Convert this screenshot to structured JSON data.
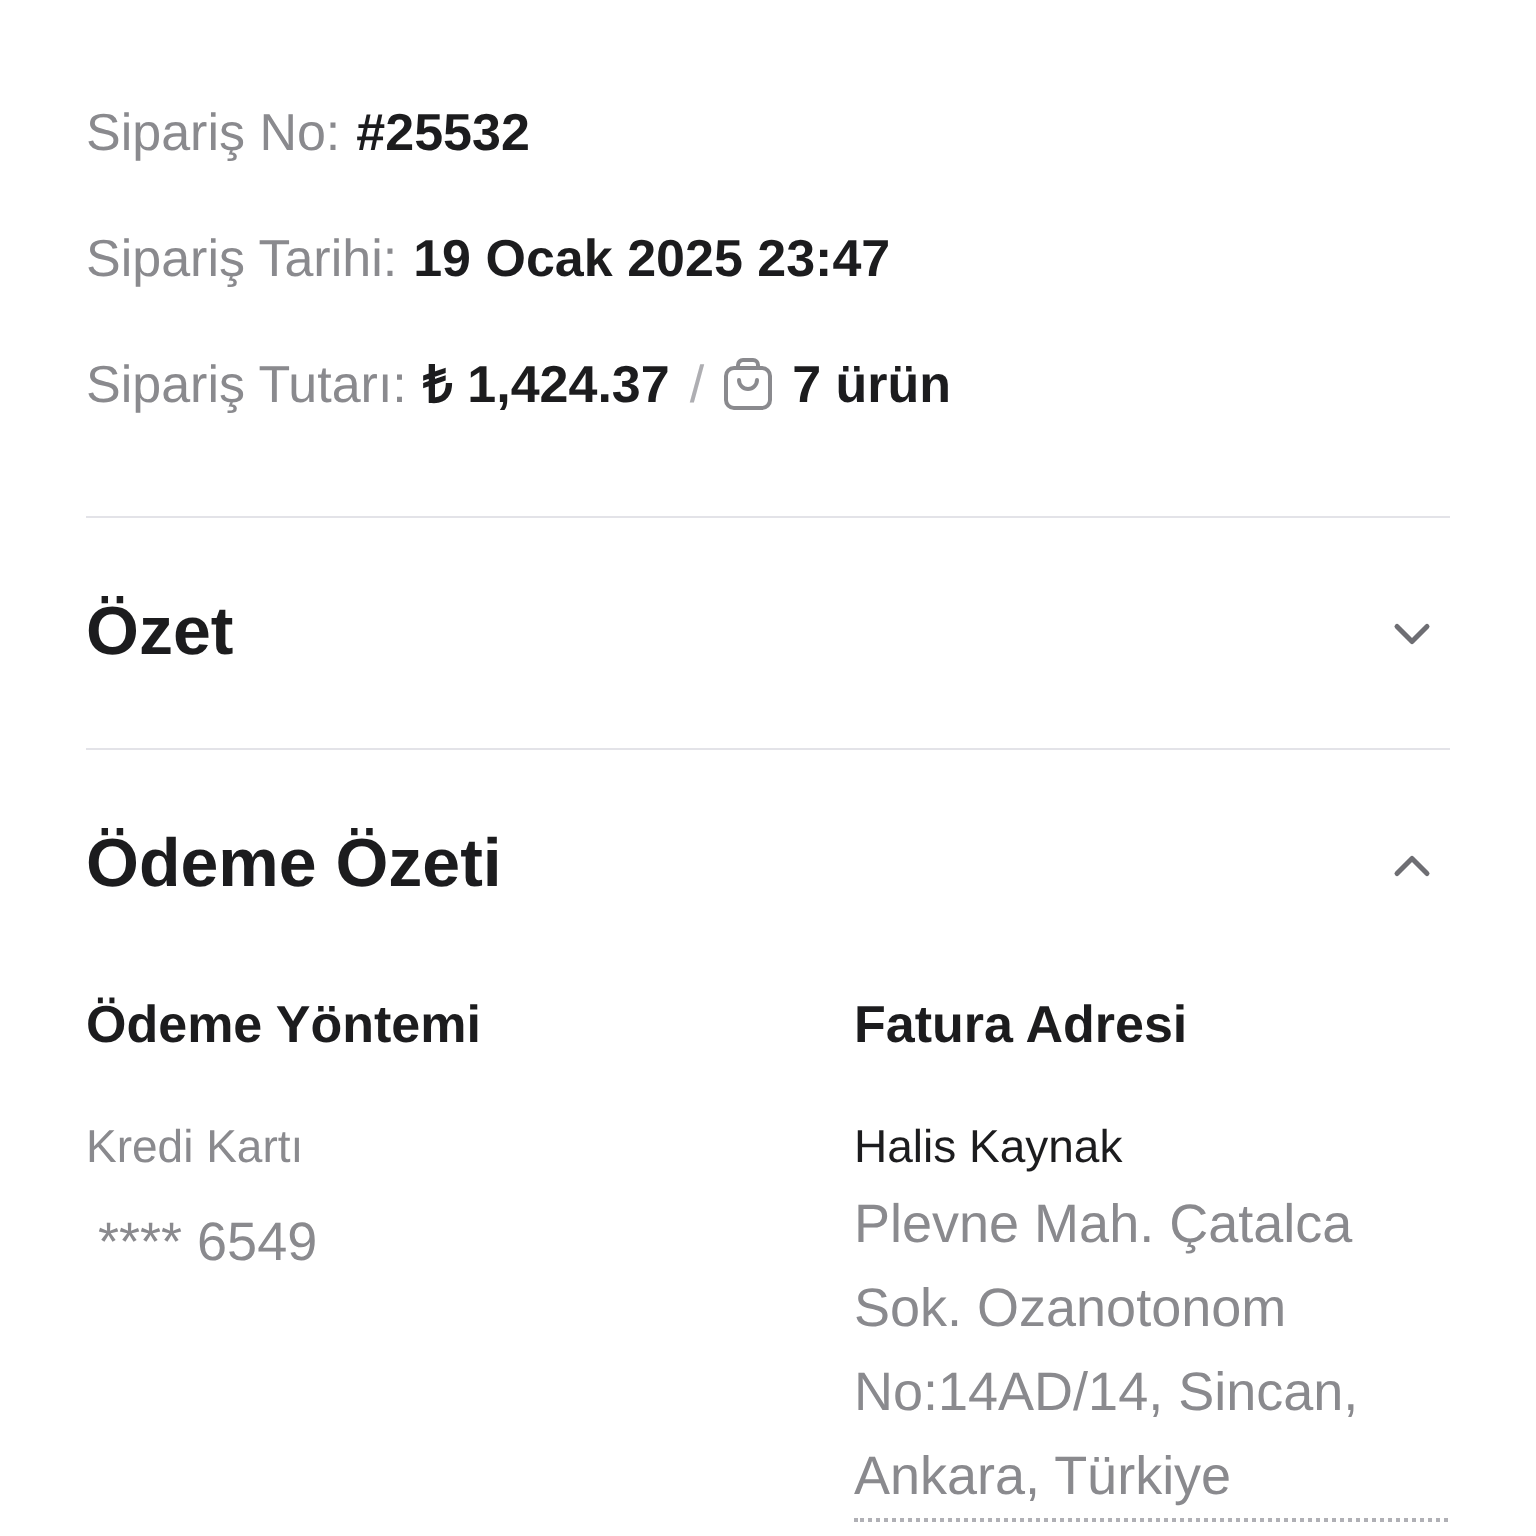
{
  "order_info": [
    {
      "label": "Sipariş No:",
      "value": "#25532"
    },
    {
      "label": "Sipariş Tarihi:",
      "value": "19 Ocak 2025 23:47"
    },
    {
      "label": "Sipariş Tutarı:",
      "value": "₺ 1,424.37",
      "separator": "/",
      "item_count": "7 ürün"
    }
  ],
  "sections": [
    {
      "title": "Özet",
      "expanded": false
    },
    {
      "title": "Ödeme Özeti",
      "expanded": true,
      "payment": {
        "heading": "Ödeme Yöntemi",
        "method": "Kredi Kartı",
        "card": "**** 6549"
      },
      "billing": {
        "heading": "Fatura Adresi",
        "name": "Halis Kaynak",
        "address": "Plevne Mah. Çatalca Sok. Ozanotonom No:14AD/14, Sincan, Ankara, Türkiye"
      }
    }
  ]
}
